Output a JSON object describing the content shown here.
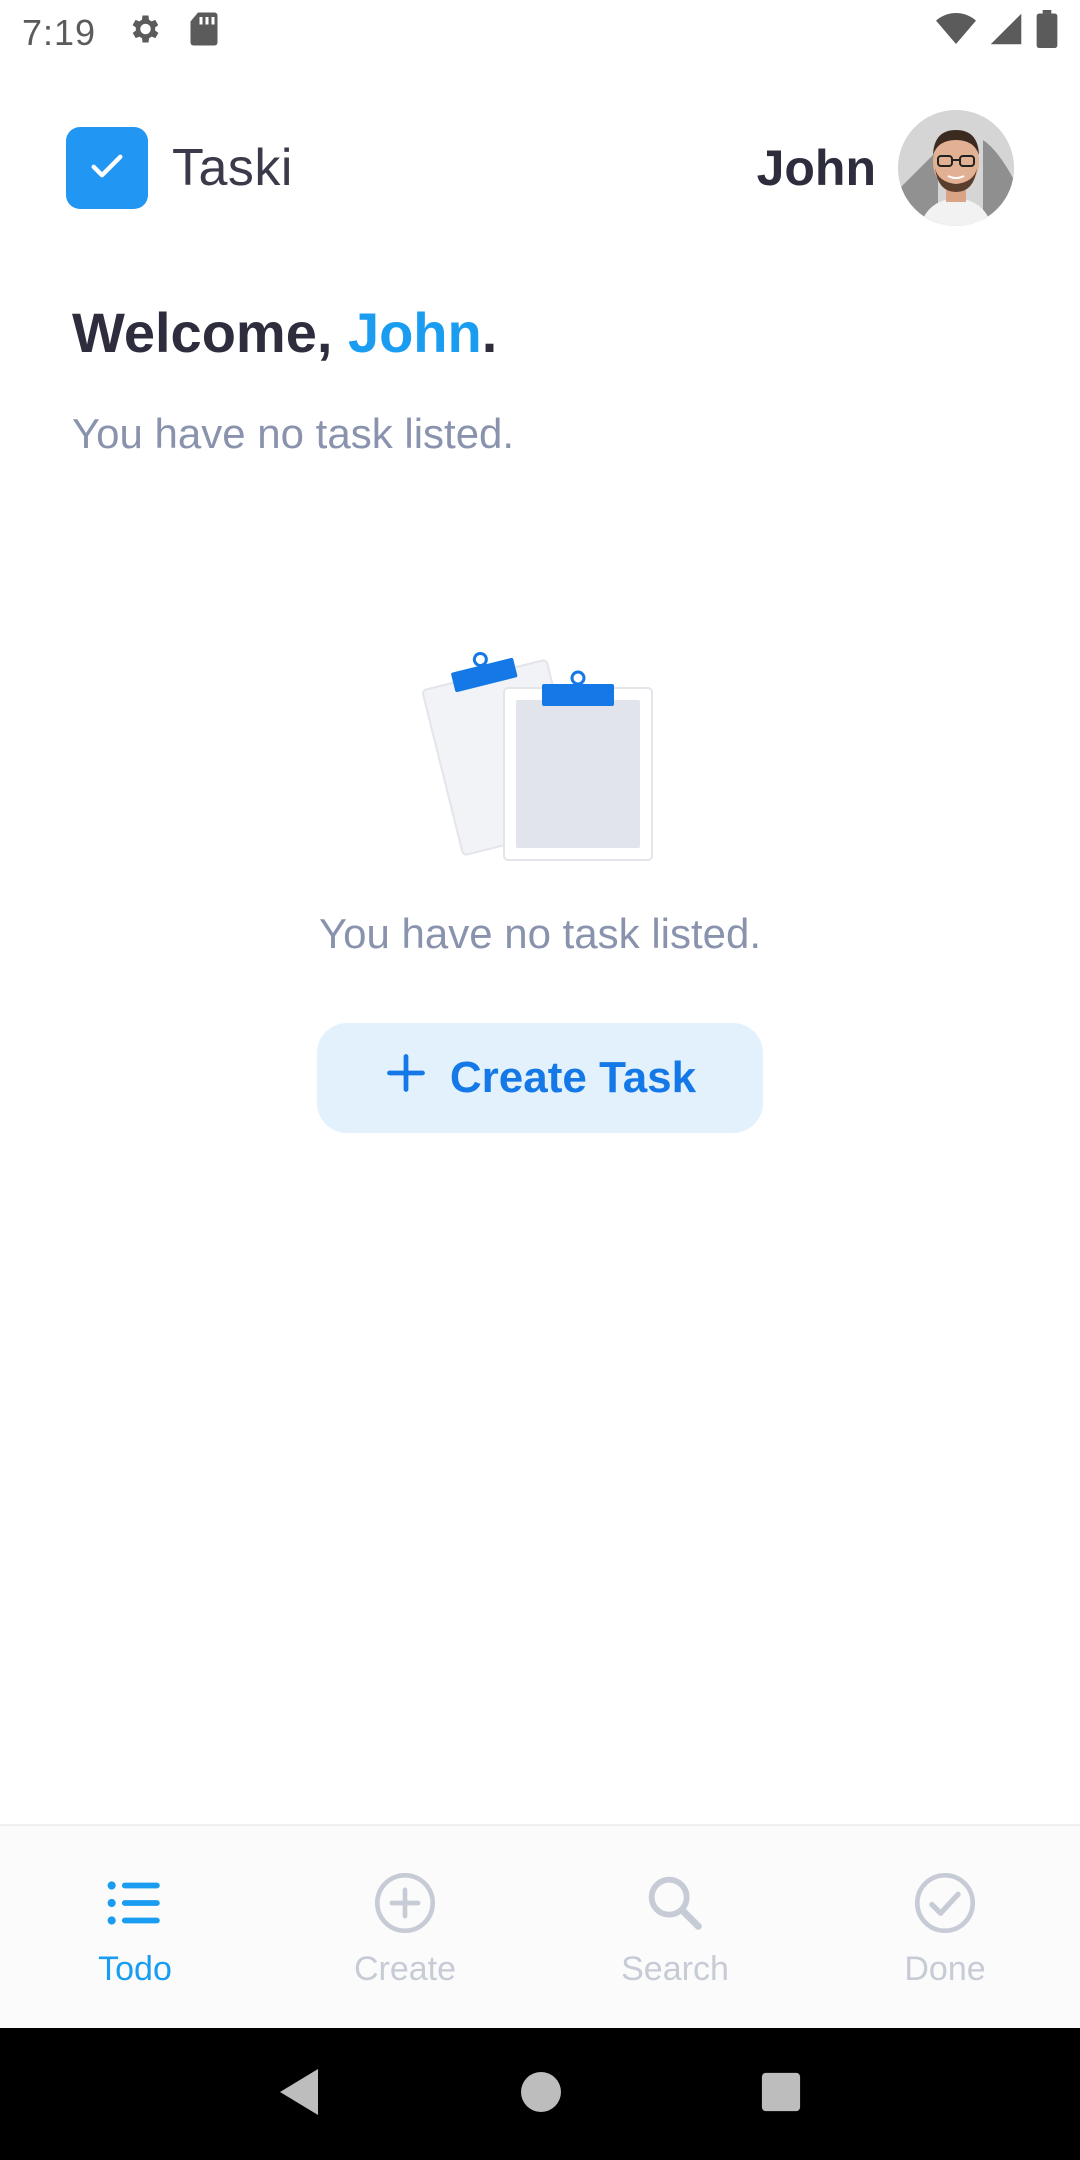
{
  "status_bar": {
    "time": "7:19"
  },
  "header": {
    "brand_name": "Taski",
    "user_name": "John"
  },
  "welcome": {
    "prefix": "Welcome, ",
    "name": "John",
    "suffix": ".",
    "subtitle": "You have no task listed."
  },
  "empty_state": {
    "message": "You have no task listed.",
    "create_button_label": "Create Task"
  },
  "bottom_nav": {
    "items": [
      {
        "label": "Todo",
        "icon": "list-icon",
        "active": true
      },
      {
        "label": "Create",
        "icon": "add-circle-icon",
        "active": false
      },
      {
        "label": "Search",
        "icon": "search-icon",
        "active": false
      },
      {
        "label": "Done",
        "icon": "check-circle-icon",
        "active": false
      }
    ]
  },
  "colors": {
    "accent": "#1a9df0",
    "logo": "#2196f3",
    "button_bg": "#e3f1fd",
    "button_text": "#1479e6",
    "muted_text": "#8a93ad",
    "inactive_nav": "#c6cbd6"
  }
}
